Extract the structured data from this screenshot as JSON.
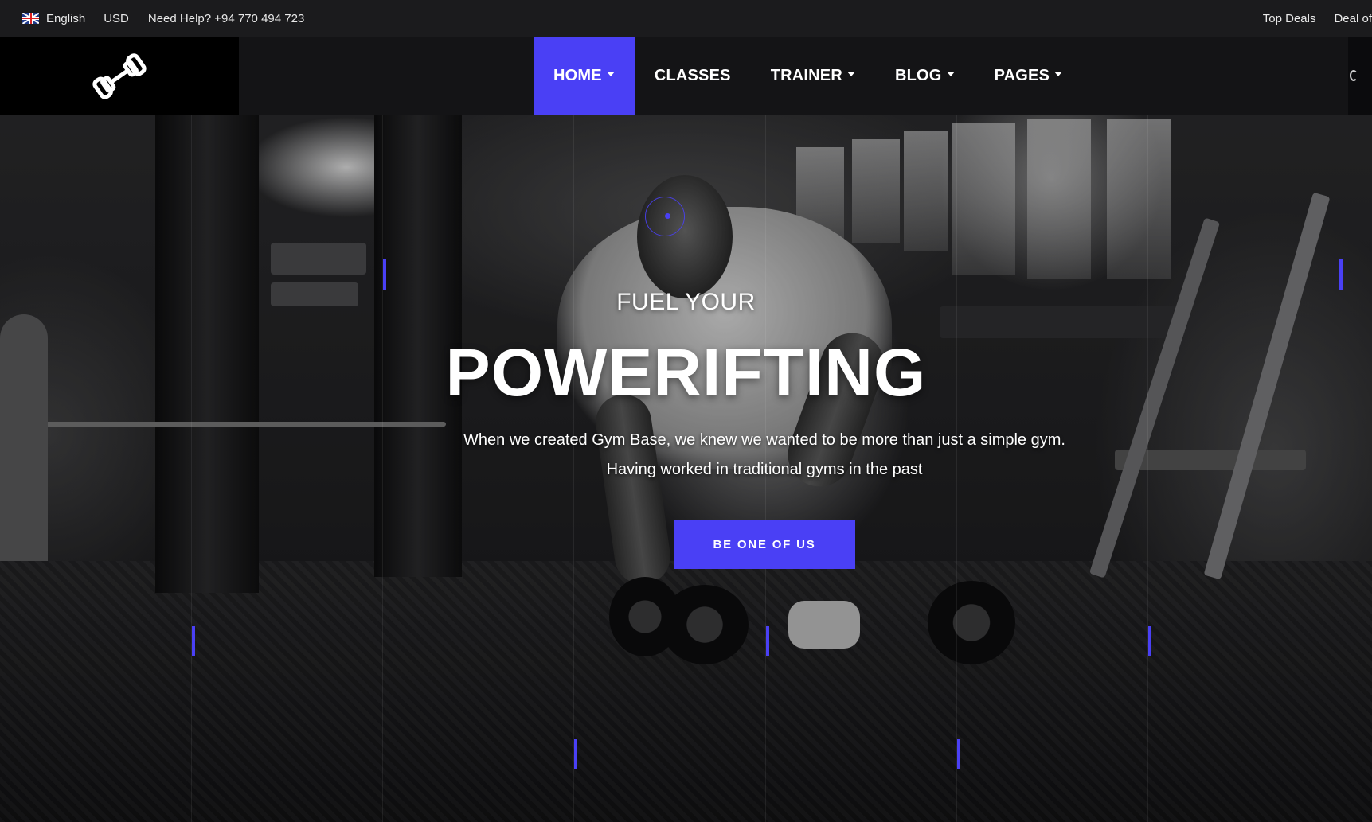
{
  "topbar": {
    "language": "English",
    "currency": "USD",
    "help_text": "Need Help? +94 770 494 723",
    "links": [
      "Top Deals",
      "Deal of"
    ]
  },
  "header": {
    "logo_icon": "dumbbell-logo-icon",
    "nav": [
      {
        "label": "HOME",
        "dropdown": true,
        "active": true
      },
      {
        "label": "CLASSES",
        "dropdown": false,
        "active": false
      },
      {
        "label": "TRAINER",
        "dropdown": true,
        "active": false
      },
      {
        "label": "BLOG",
        "dropdown": true,
        "active": false
      },
      {
        "label": "PAGES",
        "dropdown": true,
        "active": false
      }
    ]
  },
  "hero": {
    "subtitle": "FUEL YOUR",
    "title": "POWERIFTING",
    "description_line1": "When we created Gym Base, we knew we wanted to be more than just a simple gym.",
    "description_line2": "Having worked in traditional gyms in the past",
    "cta_label": "BE ONE OF US"
  },
  "colors": {
    "accent": "#4a40f5",
    "topbar_bg": "#1b1b1d",
    "header_bg": "#141416",
    "logo_bg": "#000000"
  }
}
